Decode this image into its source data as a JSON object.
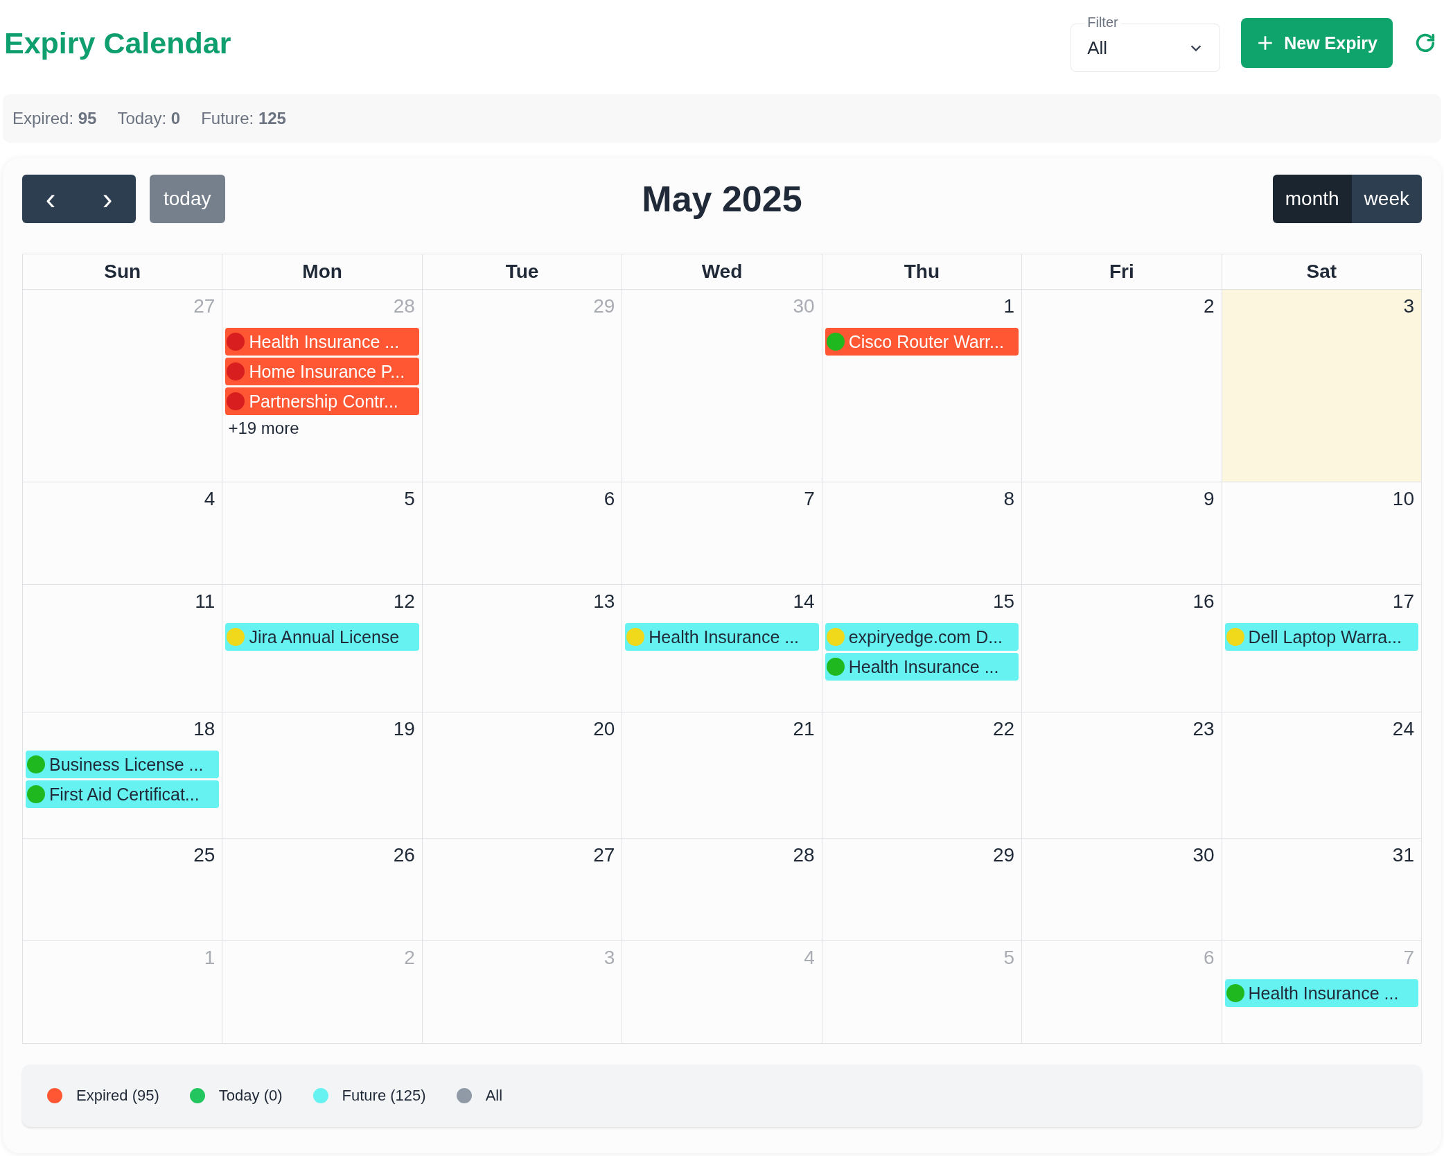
{
  "title": "Expiry Calendar",
  "filter": {
    "label": "Filter",
    "value": "All"
  },
  "new_button": {
    "label": "New Expiry"
  },
  "stats": [
    {
      "label": "Expired:",
      "value": "95"
    },
    {
      "label": "Today:",
      "value": "0"
    },
    {
      "label": "Future:",
      "value": "125"
    }
  ],
  "toolbar": {
    "prev": "‹",
    "next": "›",
    "today": "today",
    "title": "May 2025",
    "views": [
      {
        "label": "month",
        "selected": true
      },
      {
        "label": "week",
        "selected": false
      }
    ]
  },
  "weekdays": [
    "Sun",
    "Mon",
    "Tue",
    "Wed",
    "Thu",
    "Fri",
    "Sat"
  ],
  "weeks": [
    {
      "days": [
        {
          "number": "27",
          "other_month": true,
          "today": false
        },
        {
          "number": "28",
          "other_month": true,
          "today": false,
          "events": [
            {
              "title": "Health Insurance ...",
              "kind": "expired",
              "color": "#d81e1e"
            },
            {
              "title": "Home Insurance P...",
              "kind": "expired",
              "color": "#d81e1e"
            },
            {
              "title": "Partnership Contr...",
              "kind": "expired",
              "color": "#d81e1e"
            }
          ],
          "more": "+19 more"
        },
        {
          "number": "29",
          "other_month": true,
          "today": false
        },
        {
          "number": "30",
          "other_month": true,
          "today": false
        },
        {
          "number": "1",
          "other_month": false,
          "today": false,
          "events": [
            {
              "title": "Cisco Router Warr...",
              "kind": "expired",
              "color": "#1fb81f"
            }
          ]
        },
        {
          "number": "2",
          "other_month": false,
          "today": false
        },
        {
          "number": "3",
          "other_month": false,
          "today": true
        }
      ]
    },
    {
      "days": [
        {
          "number": "4",
          "other_month": false,
          "today": false
        },
        {
          "number": "5",
          "other_month": false,
          "today": false
        },
        {
          "number": "6",
          "other_month": false,
          "today": false
        },
        {
          "number": "7",
          "other_month": false,
          "today": false
        },
        {
          "number": "8",
          "other_month": false,
          "today": false
        },
        {
          "number": "9",
          "other_month": false,
          "today": false
        },
        {
          "number": "10",
          "other_month": false,
          "today": false
        }
      ]
    },
    {
      "days": [
        {
          "number": "11",
          "other_month": false,
          "today": false
        },
        {
          "number": "12",
          "other_month": false,
          "today": false,
          "events": [
            {
              "title": "Jira Annual License",
              "kind": "future",
              "color": "#f0d91a"
            }
          ]
        },
        {
          "number": "13",
          "other_month": false,
          "today": false
        },
        {
          "number": "14",
          "other_month": false,
          "today": false,
          "events": [
            {
              "title": "Health Insurance ...",
              "kind": "future",
              "color": "#f0d91a"
            }
          ]
        },
        {
          "number": "15",
          "other_month": false,
          "today": false,
          "events": [
            {
              "title": "expiryedge.com D...",
              "kind": "future",
              "color": "#f0d91a"
            },
            {
              "title": "Health Insurance ...",
              "kind": "future",
              "color": "#1fb81f"
            }
          ]
        },
        {
          "number": "16",
          "other_month": false,
          "today": false
        },
        {
          "number": "17",
          "other_month": false,
          "today": false,
          "events": [
            {
              "title": "Dell Laptop Warra...",
              "kind": "future",
              "color": "#f0d91a"
            }
          ]
        }
      ]
    },
    {
      "days": [
        {
          "number": "18",
          "other_month": false,
          "today": false,
          "events": [
            {
              "title": "Business License ...",
              "kind": "future",
              "color": "#1fb81f"
            },
            {
              "title": "First Aid Certificat...",
              "kind": "future",
              "color": "#1fb81f"
            }
          ]
        },
        {
          "number": "19",
          "other_month": false,
          "today": false
        },
        {
          "number": "20",
          "other_month": false,
          "today": false
        },
        {
          "number": "21",
          "other_month": false,
          "today": false
        },
        {
          "number": "22",
          "other_month": false,
          "today": false
        },
        {
          "number": "23",
          "other_month": false,
          "today": false
        },
        {
          "number": "24",
          "other_month": false,
          "today": false
        }
      ]
    },
    {
      "days": [
        {
          "number": "25",
          "other_month": false,
          "today": false
        },
        {
          "number": "26",
          "other_month": false,
          "today": false
        },
        {
          "number": "27",
          "other_month": false,
          "today": false
        },
        {
          "number": "28",
          "other_month": false,
          "today": false
        },
        {
          "number": "29",
          "other_month": false,
          "today": false
        },
        {
          "number": "30",
          "other_month": false,
          "today": false
        },
        {
          "number": "31",
          "other_month": false,
          "today": false
        }
      ]
    },
    {
      "days": [
        {
          "number": "1",
          "other_month": true,
          "today": false
        },
        {
          "number": "2",
          "other_month": true,
          "today": false
        },
        {
          "number": "3",
          "other_month": true,
          "today": false
        },
        {
          "number": "4",
          "other_month": true,
          "today": false
        },
        {
          "number": "5",
          "other_month": true,
          "today": false
        },
        {
          "number": "6",
          "other_month": true,
          "today": false
        },
        {
          "number": "7",
          "other_month": true,
          "today": false,
          "events": [
            {
              "title": "Health Insurance ...",
              "kind": "future",
              "color": "#1fb81f"
            }
          ]
        }
      ]
    }
  ],
  "legend": [
    {
      "label": "Expired (95)",
      "color": "#ff5733"
    },
    {
      "label": "Today (0)",
      "color": "#22c55e"
    },
    {
      "label": "Future (125)",
      "color": "#67f2f2"
    },
    {
      "label": "All",
      "color": "#909aa6"
    }
  ]
}
